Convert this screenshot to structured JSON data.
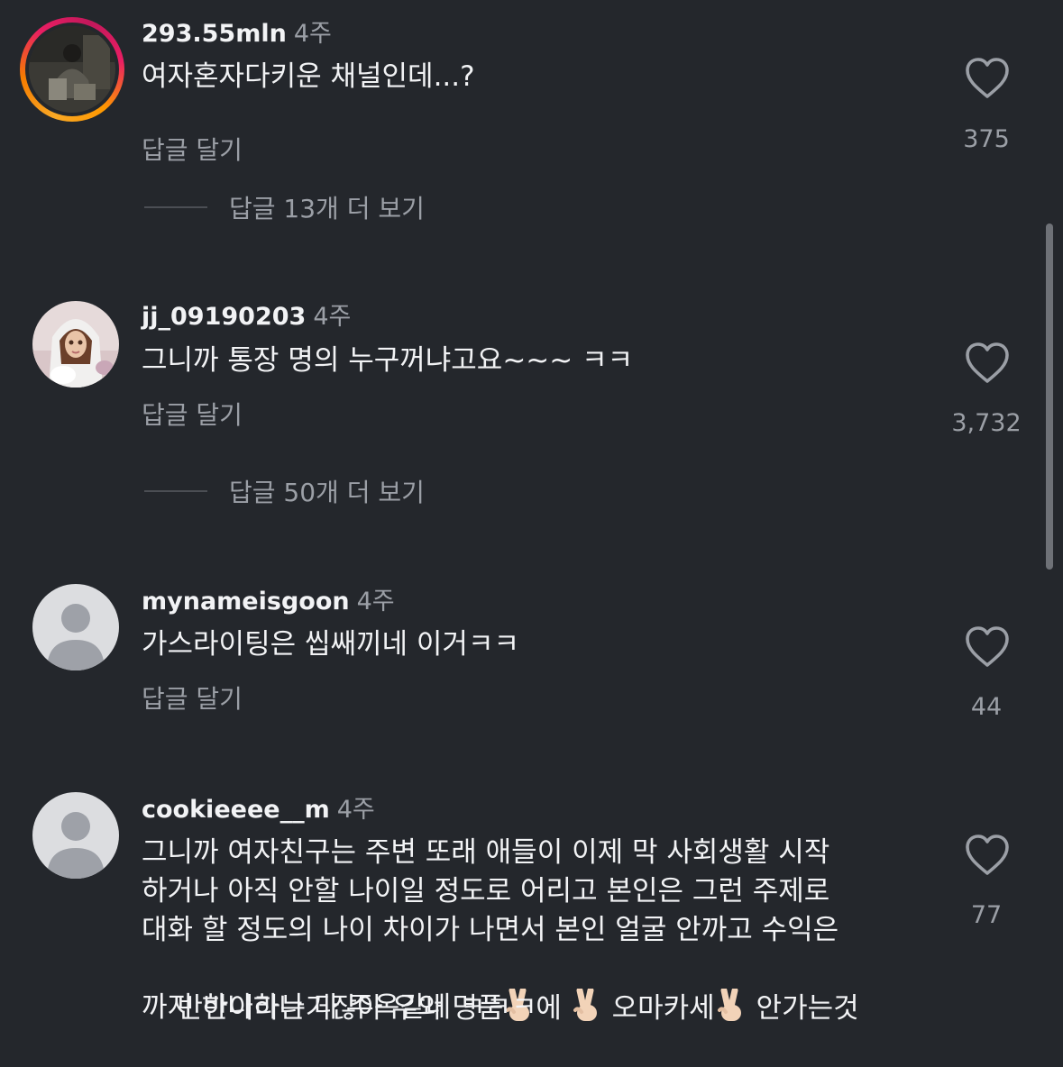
{
  "comments": [
    {
      "username": "293.55mln",
      "time": "4주",
      "text": "여자혼자다키운 채널인데...?",
      "reply_label": "답글 달기",
      "view_replies": "답글 13개 더 보기",
      "likes": "375",
      "avatar": "story-photo"
    },
    {
      "username": "jj_09190203",
      "time": "4주",
      "text": "그니까 통장 명의 누구꺼냐고요~~~ ㅋㅋ",
      "reply_label": "답글 달기",
      "view_replies": "답글 50개 더 보기",
      "likes": "3,732",
      "avatar": "doll-photo"
    },
    {
      "username": "mynameisgoon",
      "time": "4주",
      "text": "가스라이팅은 씹쌔끼네 이거ㅋㅋ",
      "reply_label": "답글 달기",
      "likes": "44",
      "avatar": "default-user"
    },
    {
      "username": "cookieeee__m",
      "time": "4주",
      "text_lines": [
        "그니까 여자친구는 주변 또래 애들이 이제 막 사회생활 시작",
        "하거나 아직 안할 나이일 정도로 어리고 본인은 그런 주제로",
        "대화 할 정도의 나이 차이가 나면서 본인 얼굴 안까고 수익은",
        "반반이라는거잖아 우와 명품",
        "에 ",
        "오마카세",
        " 안가는것",
        "까지 하나하나 다 주옥같네 ㅋㅋㅋ"
      ],
      "likes": "77",
      "avatar": "default-user"
    }
  ],
  "icons": {
    "like": "heart-outline-icon",
    "emoji": "victory-hand-emoji"
  },
  "colors": {
    "background": "#24272c",
    "primary_text": "#f2f3f5",
    "secondary_text": "#9b9fa6"
  }
}
